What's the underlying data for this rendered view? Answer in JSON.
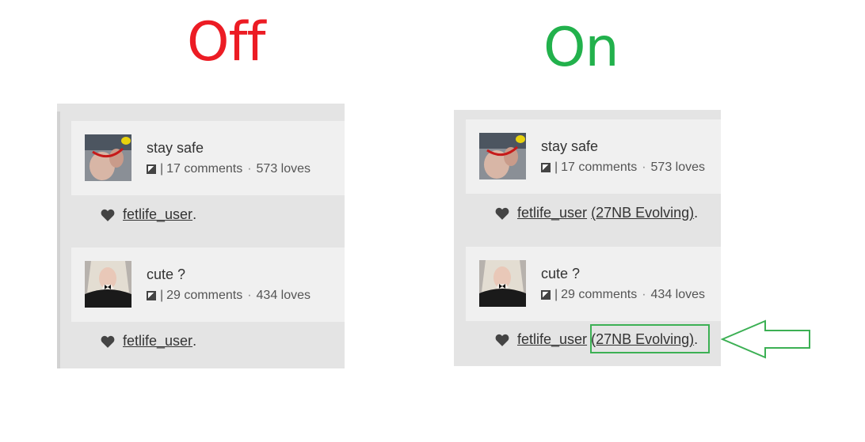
{
  "headings": {
    "off": "Off",
    "on": "On",
    "off_color": "#ec1c24",
    "on_color": "#22b14c"
  },
  "off_panel": {
    "posts": [
      {
        "title": "stay safe",
        "meta_separator": "|",
        "comments": "17 comments",
        "dot": "·",
        "loves": "573 loves",
        "icon": "picture-icon",
        "thumbnail": "photo-thumbnail",
        "love_icon": "heart-icon",
        "user_link": "fetlife_user",
        "suffix": "."
      },
      {
        "title": "cute ?",
        "meta_separator": "|",
        "comments": "29 comments",
        "dot": "·",
        "loves": "434 loves",
        "icon": "picture-icon",
        "thumbnail": "photo-thumbnail",
        "love_icon": "heart-icon",
        "user_link": "fetlife_user",
        "suffix": "."
      }
    ]
  },
  "on_panel": {
    "posts": [
      {
        "title": "stay safe",
        "meta_separator": "|",
        "comments": "17 comments",
        "dot": "·",
        "loves": "573 loves",
        "icon": "picture-icon",
        "thumbnail": "photo-thumbnail",
        "love_icon": "heart-icon",
        "user_link": "fetlife_user",
        "user_extra": "(27NB Evolving)",
        "suffix": "."
      },
      {
        "title": "cute ?",
        "meta_separator": "|",
        "comments": "29 comments",
        "dot": "·",
        "loves": "434 loves",
        "icon": "picture-icon",
        "thumbnail": "photo-thumbnail",
        "love_icon": "heart-icon",
        "user_link": "fetlife_user",
        "user_extra": "(27NB Evolving)",
        "suffix": "."
      }
    ]
  },
  "annotation": {
    "box_color": "#3cb054",
    "arrow_color": "#3cb054"
  }
}
